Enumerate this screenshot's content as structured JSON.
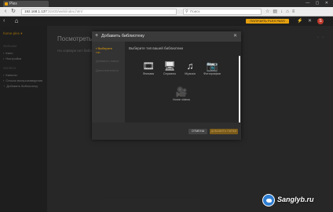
{
  "browser": {
    "tab_title": "Plex",
    "window_controls": "— ▢ ✕",
    "url_host": "192.168.1.137",
    "url_path": ":32400/web/index.html",
    "search_placeholder": "Поиск",
    "icons": [
      "star-icon",
      "bookmark-icon",
      "download-icon",
      "home-icon",
      "menu-icon"
    ]
  },
  "plex_header": {
    "premium_label": "ПОЛУЧИТЬ PLEX PASS",
    "avatar_letter": "S"
  },
  "sidebar": {
    "server_name": "home-plex",
    "sections": [
      {
        "heading": "ФИЛЬМЫ",
        "items": [
          "Кино",
          "Настройки"
        ]
      },
      {
        "heading": "ЗАПИСИ",
        "items": [
          "Каналы",
          "Список воспроизведения",
          "Добавить библиотеку"
        ]
      }
    ]
  },
  "main": {
    "title": "Посмотреть п",
    "subtitle": "На сервере нет библиотек"
  },
  "modal": {
    "title": "Добавить библиотеку",
    "close": "✕",
    "steps": [
      {
        "label": "Выберите",
        "sub": "тип",
        "active": true
      },
      {
        "label": "Добавить папки",
        "sub": "",
        "active": false
      },
      {
        "label": "Дополнительно",
        "sub": "",
        "active": false
      }
    ],
    "prompt": "Выберите тип вашей библиотеки",
    "library_types": [
      {
        "icon": "film-icon",
        "glyph": "🎞",
        "label": "Фильмы"
      },
      {
        "icon": "tv-icon",
        "glyph": "🖥",
        "label": "Сериалы"
      },
      {
        "icon": "music-icon",
        "glyph": "♫",
        "label": "Музыка"
      },
      {
        "icon": "camera-icon",
        "glyph": "📷",
        "label": "Фотографии"
      },
      {
        "icon": "video-camera-icon",
        "glyph": "🎥",
        "label": "Home videos"
      }
    ],
    "cancel_label": "ОТМЕНА",
    "next_label": "ДОБАВИТЬ ПАПКИ"
  },
  "watermark": {
    "text": "Sanglyb.ru"
  },
  "colors": {
    "accent": "#e5a00d",
    "background": "#3d3d3d",
    "modal": "#282828"
  }
}
